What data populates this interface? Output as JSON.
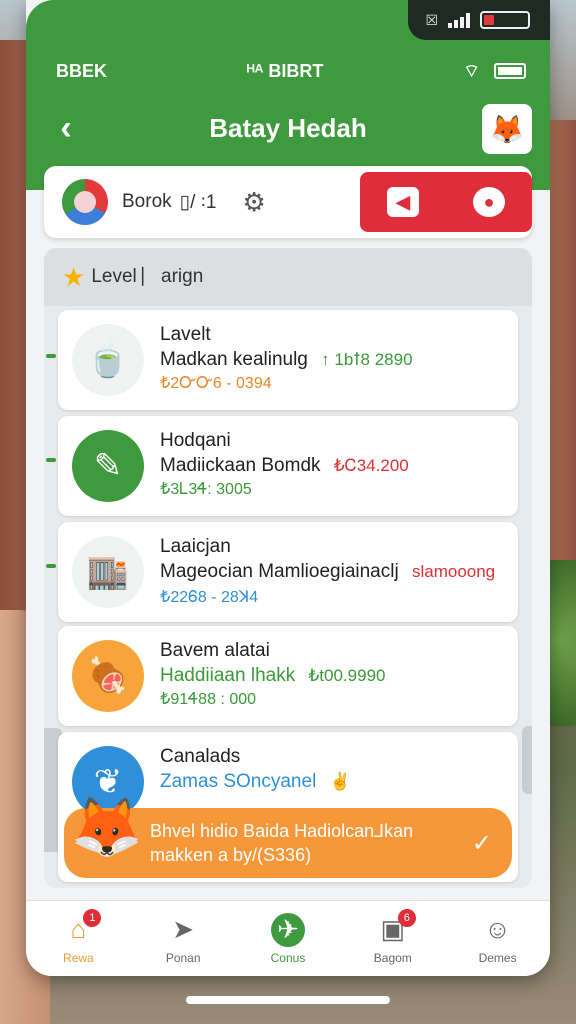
{
  "status": {
    "carrier": "BBEK",
    "center": "ᴴᴬ BIBRT",
    "notch_icon": "☒"
  },
  "header": {
    "title": "Batay Hedah",
    "back_icon": "chevron-left-icon",
    "avatar_icon": "fox-avatar-icon"
  },
  "toolbar": {
    "label": "Borok",
    "counter": "▯/ ꞉1",
    "gear_icon": "gear-icon"
  },
  "level": {
    "title": "Level ⎸arign"
  },
  "cards": [
    {
      "title": "Lavelt",
      "line": "Madkan kealinulg",
      "amount": "↑ 1bꝉ8 2890",
      "amount_color": "#3a9a3a",
      "code": "₺2ᏅᏅ6 - 0394",
      "code_color": "#e8862a",
      "icon": "tea-cup-icon",
      "icon_bg": "#eef3f2"
    },
    {
      "title": "Hodqani",
      "line": "Madiickaan Bomdk",
      "amount": "₺Ꮯ34.200",
      "amount_color": "#d83232",
      "code": "₺3Ꮮ3Ꮞ: 3005",
      "code_color": "#3a9a3a",
      "icon": "edit-square-icon",
      "icon_bg": "#3f9a3f"
    },
    {
      "title": "Laaicjan",
      "line": "Mageocian Mamlioegiainaclj",
      "amount": "slamooong",
      "amount_color": "#d83232",
      "code": "₺22Ꮾ8 - 28ꓘ4",
      "code_color": "#2f8fd8",
      "icon": "shop-building-icon",
      "icon_bg": "#eef3f2"
    },
    {
      "title": "Bavem alatai",
      "line": "Haddiiaan lhakk",
      "amount": "₺t00.9990",
      "amount_color": "#3a9a3a",
      "code": "₺91Ꮞ88 : 000",
      "code_color": "#3a9a3a",
      "icon": "food-icon",
      "icon_bg": "#f7a53a"
    },
    {
      "title": "Canalads",
      "line": "Zamas SOncyanel",
      "amount": "",
      "amount_color": "#2f8fd8",
      "code": "",
      "code_color": "#2f8fd8",
      "icon": "leaf-icon",
      "icon_bg": "#2f8fd8"
    }
  ],
  "promo": {
    "line1": "Bhvel hidio Baida Hadiolcan⅃kan",
    "line2": "makken a by/(S336)",
    "mascot_icon": "fox-mascot-icon",
    "check_icon": "check-icon"
  },
  "nav": [
    {
      "label": "Rewa",
      "icon": "home-icon",
      "glyph": "⌂",
      "badge": "1",
      "active": true
    },
    {
      "label": "Ponan",
      "icon": "send-icon",
      "glyph": "➤",
      "badge": "",
      "active": false
    },
    {
      "label": "Conus",
      "icon": "plane-icon",
      "glyph": "✈",
      "badge": "",
      "active": false
    },
    {
      "label": "Bagom",
      "icon": "inbox-icon",
      "glyph": "▣",
      "badge": "6",
      "active": false
    },
    {
      "label": "Demes",
      "icon": "profile-icon",
      "glyph": "☺",
      "badge": "",
      "active": false
    }
  ],
  "colors": {
    "brand_green": "#3f9a3f",
    "accent_red": "#df2e3a",
    "accent_orange": "#f6983a"
  }
}
